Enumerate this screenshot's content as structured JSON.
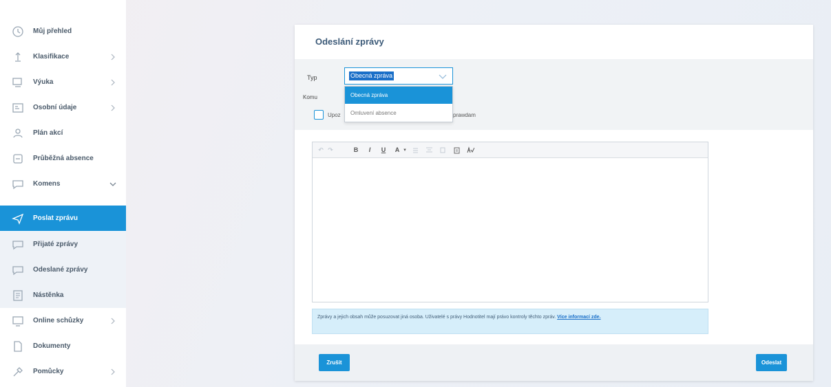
{
  "colors": {
    "accent": "#1a93d8",
    "title": "#3c5a78",
    "info_bg": "#d6eefa"
  },
  "sidebar": {
    "items": [
      {
        "label": "Můj přehled",
        "icon": "clock-icon",
        "chevron": ""
      },
      {
        "label": "Klasifikace",
        "icon": "grade-icon",
        "chevron": "right"
      },
      {
        "label": "Výuka",
        "icon": "teaching-icon",
        "chevron": "right"
      },
      {
        "label": "Osobní údaje",
        "icon": "personal-data-icon",
        "chevron": "right"
      },
      {
        "label": "Plán akcí",
        "icon": "people-icon",
        "chevron": ""
      },
      {
        "label": "Průběžná absence",
        "icon": "absence-icon",
        "chevron": ""
      },
      {
        "label": "Komens",
        "icon": "chat-icon",
        "chevron": "down"
      },
      {
        "label": "Poslat zprávu",
        "icon": "send-icon",
        "chevron": ""
      },
      {
        "label": "Přijaté zprávy",
        "icon": "inbox-icon",
        "chevron": ""
      },
      {
        "label": "Odeslané zprávy",
        "icon": "outbox-icon",
        "chevron": ""
      },
      {
        "label": "Nástěnka",
        "icon": "noticeboard-icon",
        "chevron": ""
      },
      {
        "label": "Online schůzky",
        "icon": "meeting-icon",
        "chevron": "right"
      },
      {
        "label": "Dokumenty",
        "icon": "document-icon",
        "chevron": ""
      },
      {
        "label": "Pomůcky",
        "icon": "tools-icon",
        "chevron": "right"
      }
    ]
  },
  "form": {
    "title": "Odeslání zprávy",
    "type_label": "Typ",
    "type_value": "Obecná zpráva",
    "to_label": "Komu",
    "options": [
      "Obecná zpráva",
      "Omluvení absence"
    ],
    "checkbox_prefix": "Upoz",
    "checkbox_suffix": "prawdam",
    "toolbar": [
      "↶",
      "↷",
      "B",
      "I",
      "U",
      "A",
      "▾"
    ],
    "info_text": "Zprávy a jejich obsah může posuzovat jiná osoba. Uživatelé s právy Hodnotitel mají právo kontroly těchto zpráv.",
    "info_link": "Více informací zde.",
    "cancel_label": "Zrušit",
    "send_label": "Odeslat"
  }
}
